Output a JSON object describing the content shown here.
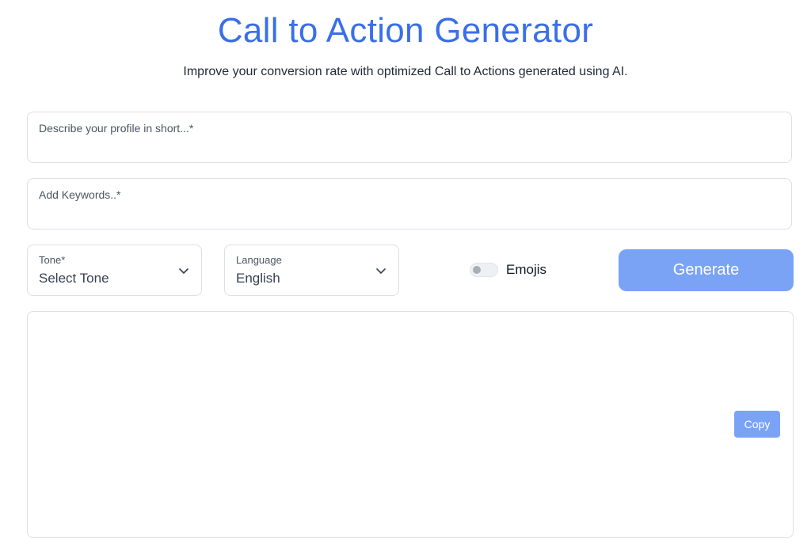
{
  "header": {
    "title": "Call to Action Generator",
    "subtitle": "Improve your conversion rate with optimized Call to Actions generated using AI."
  },
  "form": {
    "profile_placeholder": "Describe your profile in short...*",
    "keywords_placeholder": "Add Keywords..*",
    "tone": {
      "label": "Tone*",
      "value": "Select Tone"
    },
    "language": {
      "label": "Language",
      "value": "English"
    },
    "emojis": {
      "label": "Emojis",
      "enabled": false
    },
    "generate_label": "Generate"
  },
  "output": {
    "copy_label": "Copy"
  },
  "colors": {
    "accent": "#3b6fe8",
    "button": "#7aa3f5",
    "border": "#dcdfe5"
  },
  "icons": {
    "select_arrow": "chevron-down-icon",
    "toggle": "toggle-switch"
  }
}
